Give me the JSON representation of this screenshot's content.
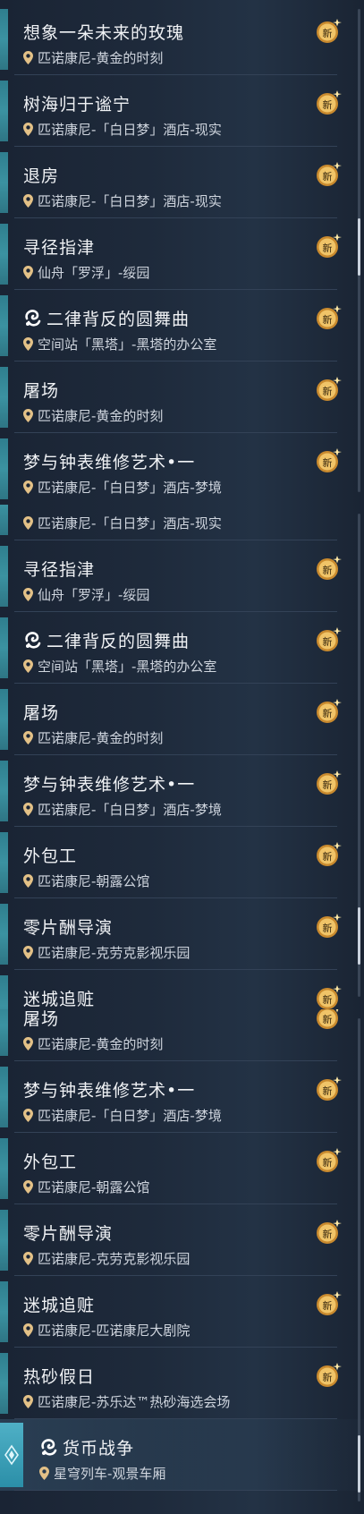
{
  "panels": [
    {
      "items": [
        {
          "title": "想象一朵未来的玫瑰",
          "location": "匹诺康尼-黄金的时刻",
          "icon": null
        },
        {
          "title": "树海归于谧宁",
          "location": "匹诺康尼-「白日梦」酒店-现实",
          "icon": null
        },
        {
          "title": "退房",
          "location": "匹诺康尼-「白日梦」酒店-现实",
          "icon": null
        },
        {
          "title": "寻径指津",
          "location": "仙舟「罗浮」-绥园",
          "icon": null
        },
        {
          "title": "二律背反的圆舞曲",
          "location": "空间站「黑塔」-黑塔的办公室",
          "icon": "swirl"
        },
        {
          "title": "屠场",
          "location": "匹诺康尼-黄金的时刻",
          "icon": null
        },
        {
          "title": "梦与钟表维修艺术•一",
          "location": "匹诺康尼-「白日梦」酒店-梦境",
          "icon": null
        }
      ]
    },
    {
      "partial_top_location": "匹诺康尼-「白日梦」酒店-现实",
      "items": [
        {
          "title": "寻径指津",
          "location": "仙舟「罗浮」-绥园",
          "icon": null
        },
        {
          "title": "二律背反的圆舞曲",
          "location": "空间站「黑塔」-黑塔的办公室",
          "icon": "swirl"
        },
        {
          "title": "屠场",
          "location": "匹诺康尼-黄金的时刻",
          "icon": null
        },
        {
          "title": "梦与钟表维修艺术•一",
          "location": "匹诺康尼-「白日梦」酒店-梦境",
          "icon": null
        },
        {
          "title": "外包工",
          "location": "匹诺康尼-朝露公馆",
          "icon": null
        },
        {
          "title": "零片酬导演",
          "location": "匹诺康尼-克劳克影视乐园",
          "icon": null
        },
        {
          "title": "迷城追赃",
          "location": "",
          "icon": null
        }
      ]
    },
    {
      "partial_top_title": "屠场",
      "partial_top_location": "匹诺康尼-黄金的时刻",
      "items": [
        {
          "title": "梦与钟表维修艺术•一",
          "location": "匹诺康尼-「白日梦」酒店-梦境",
          "icon": null
        },
        {
          "title": "外包工",
          "location": "匹诺康尼-朝露公馆",
          "icon": null
        },
        {
          "title": "零片酬导演",
          "location": "匹诺康尼-克劳克影视乐园",
          "icon": null
        },
        {
          "title": "迷城追赃",
          "location": "匹诺康尼-匹诺康尼大剧院",
          "icon": null
        },
        {
          "title": "热砂假日",
          "location": "匹诺康尼-苏乐达™热砂海选会场",
          "icon": null
        },
        {
          "title": "货币战争",
          "location": "星穹列车-观景车厢",
          "icon": "swirl",
          "no_badge": true,
          "highlight": true
        }
      ]
    }
  ],
  "badge_label": "新",
  "colors": {
    "accent": "#d8a94a",
    "stripe": "#3b92a1",
    "text": "#f0f2f5"
  }
}
